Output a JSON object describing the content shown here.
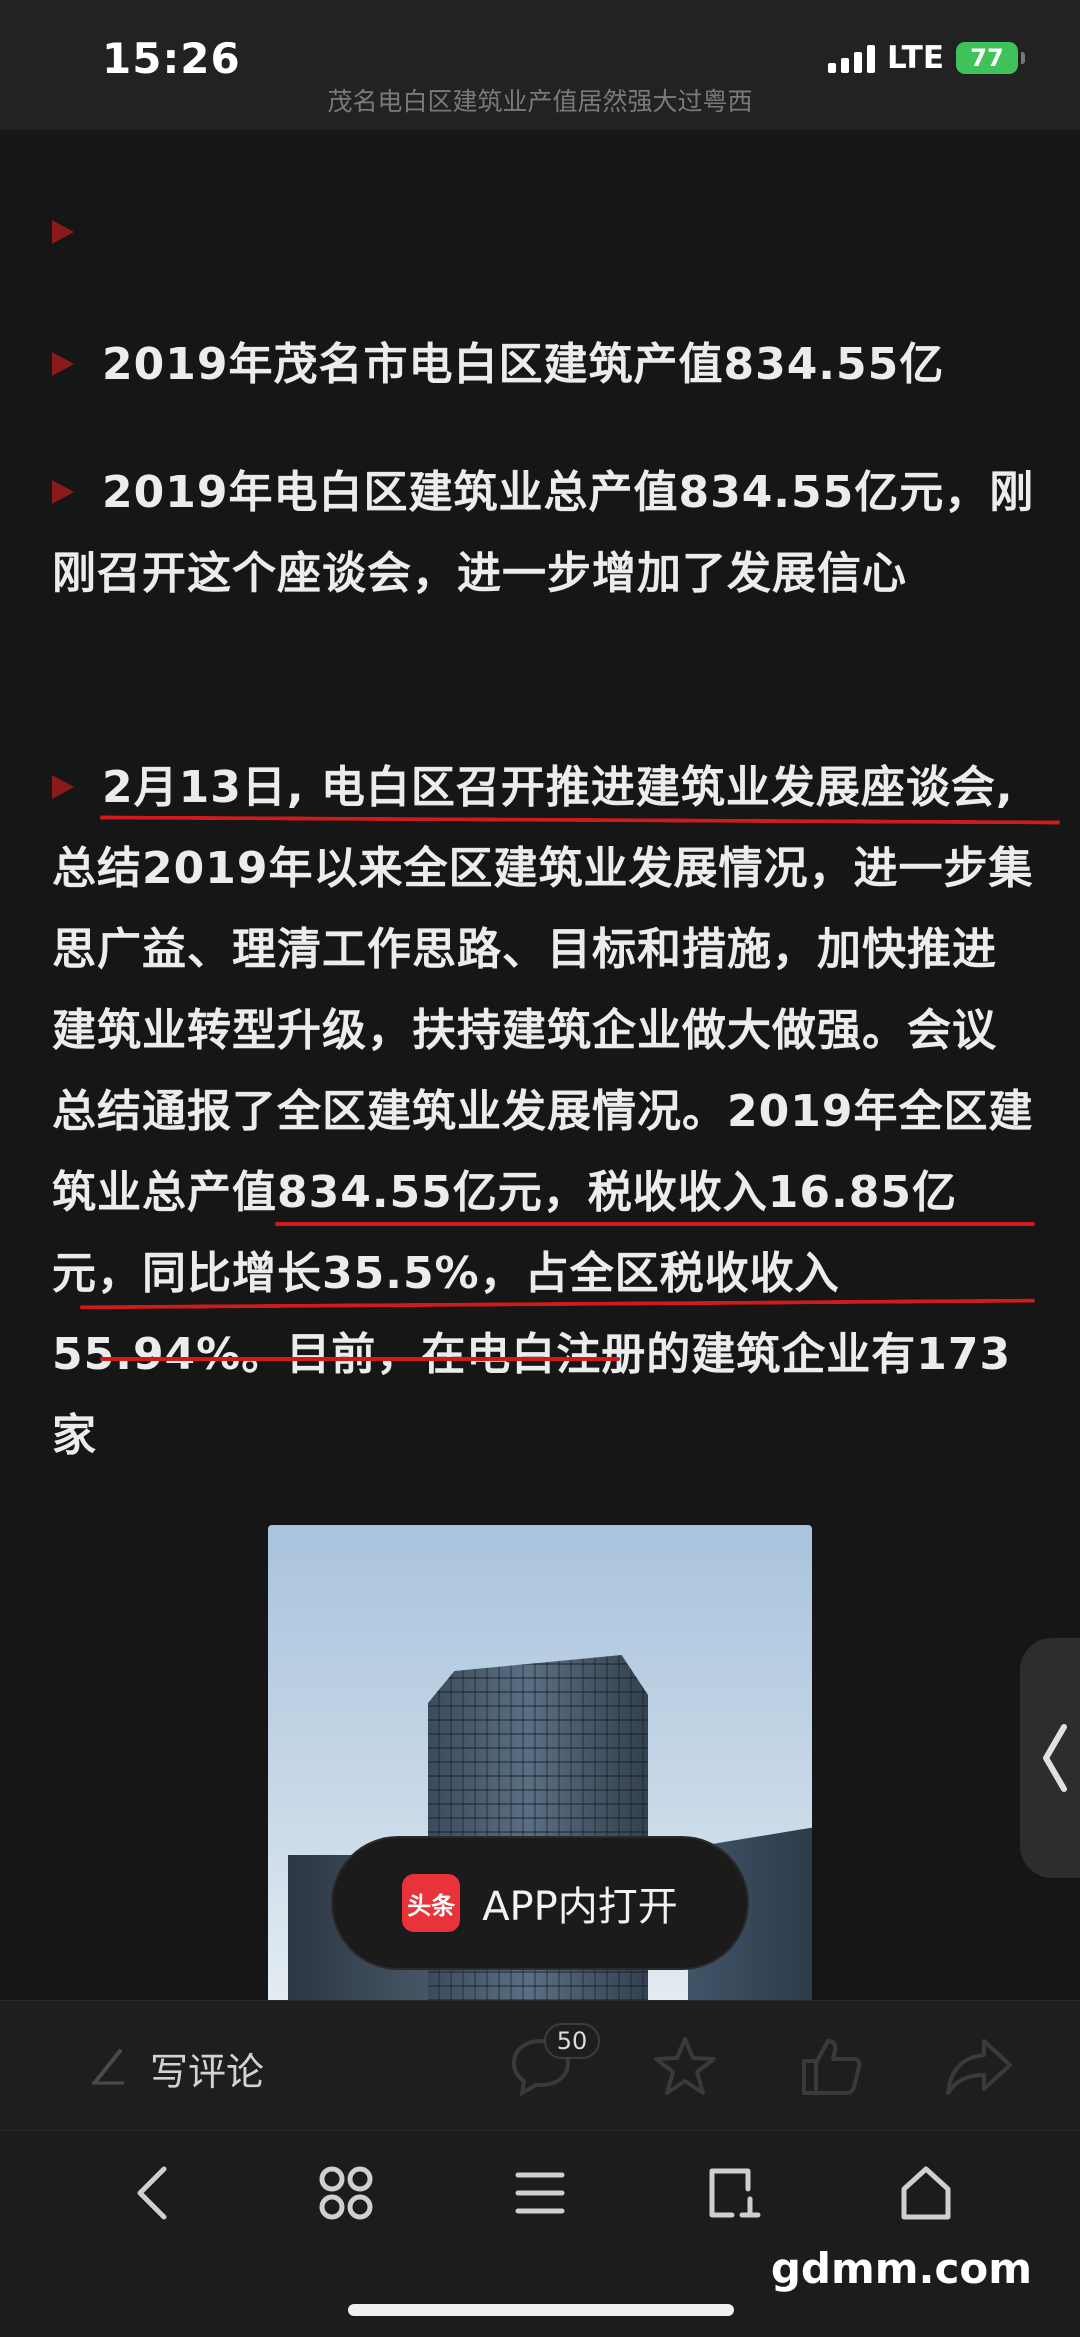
{
  "status_bar": {
    "time": "15:26",
    "network": "LTE",
    "battery": "77"
  },
  "page": {
    "title": "茂名电白区建筑业产值居然强大过粤西"
  },
  "article": {
    "paragraphs": [
      {
        "text": ""
      },
      {
        "text": "2019年茂名市电白区建筑产值834.55亿"
      },
      {
        "text": "2019年电白区建筑业总产值834.55亿元，刚刚召开这个座谈会，进一步增加了发展信心"
      },
      {
        "text": "2月13日, 电白区召开推进建筑业发展座谈会, 总结2019年以来全区建筑业发展情况，进一步集思广益、理清工作思路、目标和措施，加快推进建筑业转型升级，扶持建筑企业做大做强。会议总结通报了全区建筑业发展情况。2019年全区建筑业总产值834.55亿元，税收收入16.85亿元，同比增长35.5%，占全区税收收入55.94%。目前，在电白注册的建筑企业有173家"
      }
    ]
  },
  "open_app": {
    "logo_text": "头条",
    "label": "APP内打开"
  },
  "comment_bar": {
    "placeholder": "写评论",
    "comment_count": "50"
  },
  "watermark": "gdmm.com",
  "colors": {
    "background": "#161616",
    "bullet": "#8b1a1a",
    "underline": "#d11a1a",
    "battery": "#40c25a",
    "app_logo": "#e8333a"
  }
}
